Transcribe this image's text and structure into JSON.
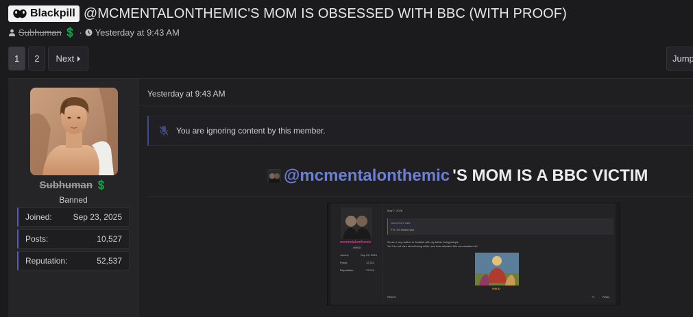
{
  "thread": {
    "prefix_label": "Blackpill",
    "title": "@MCMENTALONTHEMIC'S MOM IS OBSESSED WITH BBC (WITH PROOF)",
    "author": "Subhuman",
    "author_badge": "💲",
    "separator": "·",
    "timestamp": "Yesterday at 9:43 AM"
  },
  "pagination": {
    "pages": [
      "1",
      "2"
    ],
    "current": "1",
    "next_label": "Next",
    "jump_label": "Jump"
  },
  "post": {
    "user": {
      "name": "Subhuman",
      "badge": "💲",
      "title": "Banned",
      "stats": [
        {
          "label": "Joined:",
          "value": "Sep 23, 2025"
        },
        {
          "label": "Posts:",
          "value": "10,527"
        },
        {
          "label": "Reputation:",
          "value": "52,537"
        }
      ]
    },
    "date": "Yesterday at 9:43 AM",
    "ignore_notice": "You are ignoring content by this member.",
    "headline_mention": "@mcmentalonthemic",
    "headline_rest": " 'S MOM IS A BBC VICTIM",
    "embedded": {
      "date": "May 7, 2026",
      "quote_author": "cachemore said:",
      "quote_text": "FYI, I'm mixed race.",
      "line1": "So am I, my mother is Scottish with my father being kabyle",
      "line2": "Yet I do not care about being white, see how retarded this conversation is?",
      "username": "mcmentalonthemic",
      "user_title": "WIKID",
      "stats": [
        {
          "label": "Joined:",
          "value": "Sep 23, 2023"
        },
        {
          "label": "Posts:",
          "value": "12,512"
        },
        {
          "label": "Reputation:",
          "value": "37,014"
        }
      ],
      "sig": "WIKID",
      "report": "Report",
      "reaction": "+1",
      "reply": "Reply"
    }
  },
  "colors": {
    "accent": "#5561b0",
    "mention": "#6c7fd6",
    "background": "#1b1b1d"
  },
  "icons": [
    "blackpill-icon",
    "user-icon",
    "clock-icon",
    "chevron-right-icon",
    "muted-icon"
  ]
}
